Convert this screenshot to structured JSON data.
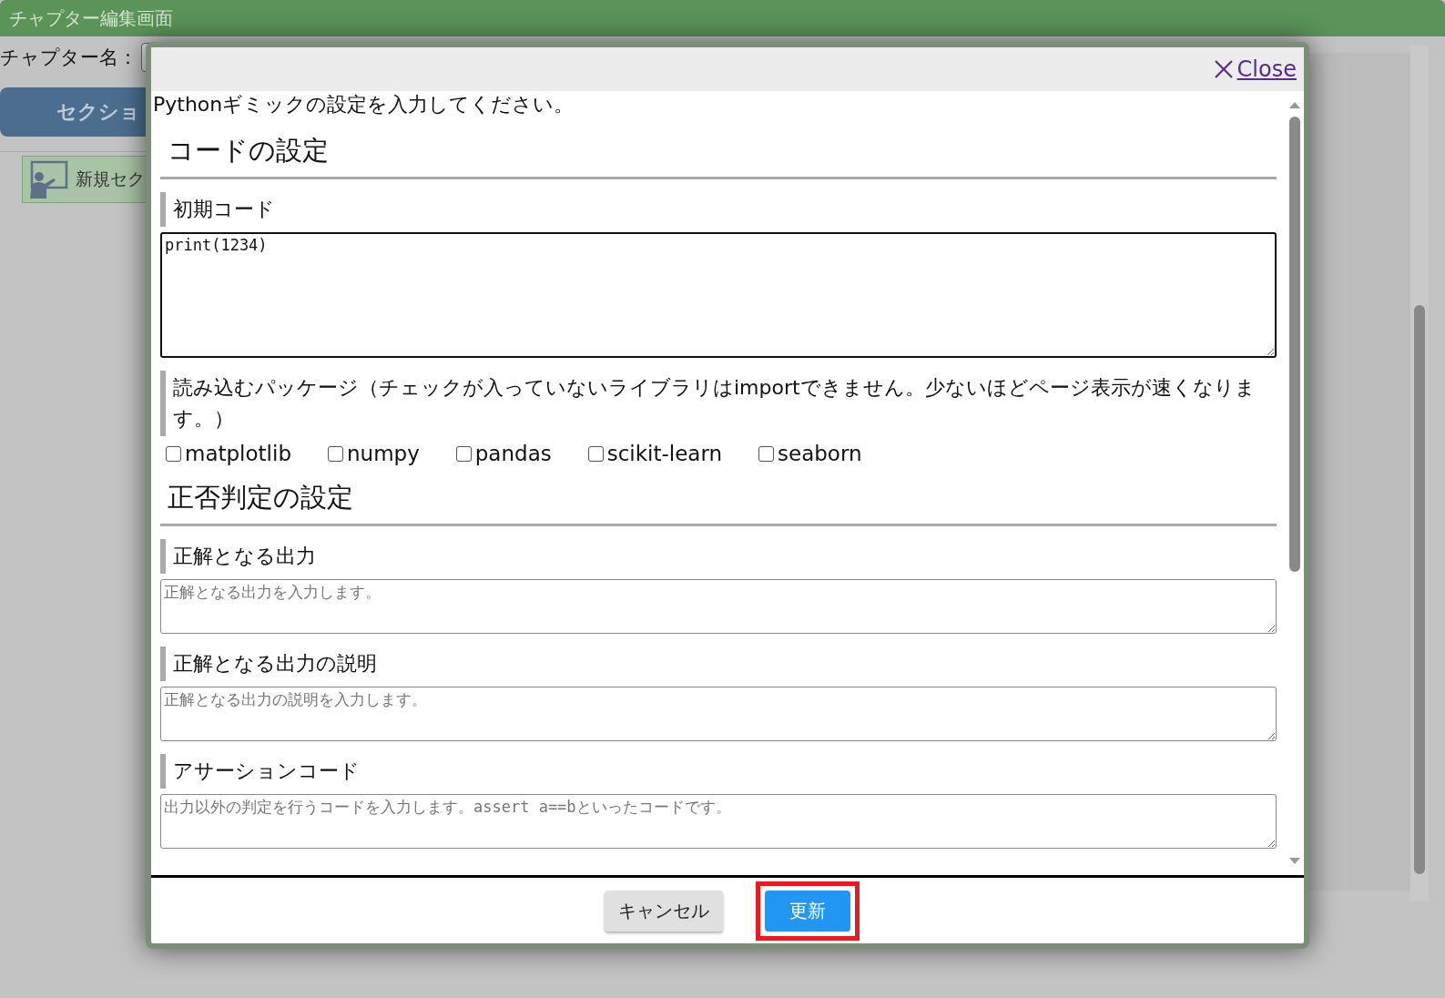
{
  "page": {
    "title": "チャプター編集画面",
    "chapter_name_label": "チャプター名：",
    "section_button": "セクショ",
    "sidebar_item": "新規セク"
  },
  "modal": {
    "close_label": "Close",
    "intro": "Pythonギミックの設定を入力してください。",
    "sections": [
      {
        "heading": "コードの設定",
        "fields": [
          {
            "kind": "code",
            "label": "初期コード",
            "value": "print(1234)"
          },
          {
            "kind": "checkboxes",
            "label": "読み込むパッケージ（チェックが入っていないライブラリはimportできません。少ないほどページ表示が速くなります。）",
            "options": [
              {
                "label": "matplotlib",
                "checked": false
              },
              {
                "label": "numpy",
                "checked": false
              },
              {
                "label": "pandas",
                "checked": false
              },
              {
                "label": "scikit-learn",
                "checked": false
              },
              {
                "label": "seaborn",
                "checked": false
              }
            ]
          }
        ]
      },
      {
        "heading": "正否判定の設定",
        "fields": [
          {
            "kind": "textarea",
            "label": "正解となる出力",
            "placeholder": "正解となる出力を入力します。"
          },
          {
            "kind": "textarea",
            "label": "正解となる出力の説明",
            "placeholder": "正解となる出力の説明を入力します。"
          },
          {
            "kind": "textarea",
            "label": "アサーションコード",
            "placeholder": "出力以外の判定を行うコードを入力します。assert a==bといったコードです。"
          }
        ]
      }
    ],
    "buttons": [
      {
        "label": "キャンセル",
        "kind": "secondary",
        "highlighted": false
      },
      {
        "label": "更新",
        "kind": "primary",
        "highlighted": true
      }
    ]
  }
}
